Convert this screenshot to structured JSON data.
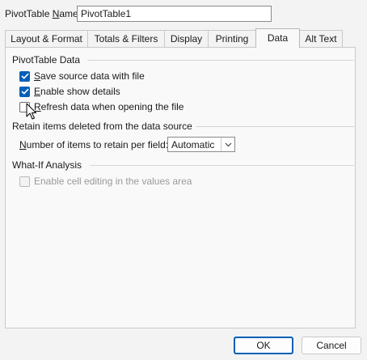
{
  "name_row": {
    "label_pre": "PivotTable ",
    "label_key": "N",
    "label_post": "ame:",
    "value": "PivotTable1"
  },
  "tabs": [
    {
      "label": "Layout & Format",
      "active": false
    },
    {
      "label": "Totals & Filters",
      "active": false
    },
    {
      "label": "Display",
      "active": false
    },
    {
      "label": "Printing",
      "active": false
    },
    {
      "label": "Data",
      "active": true
    },
    {
      "label": "Alt Text",
      "active": false
    }
  ],
  "pivot_data": {
    "title": "PivotTable Data",
    "save_source": {
      "key": "S",
      "rest": "ave source data with file",
      "checked": true
    },
    "show_details": {
      "key": "E",
      "rest": "nable show details",
      "checked": true
    },
    "refresh": {
      "key": "R",
      "rest": "efresh data when opening the file",
      "checked": false
    }
  },
  "retain": {
    "title": "Retain items deleted from the data source",
    "label_key": "N",
    "label_rest": "umber of items to retain per field:",
    "selected": "Automatic"
  },
  "whatif": {
    "title": "What-If Analysis",
    "enable_editing": {
      "label": "Enable cell editing in the values area",
      "checked": false,
      "enabled": false
    }
  },
  "buttons": {
    "ok": "OK",
    "cancel": "Cancel"
  }
}
